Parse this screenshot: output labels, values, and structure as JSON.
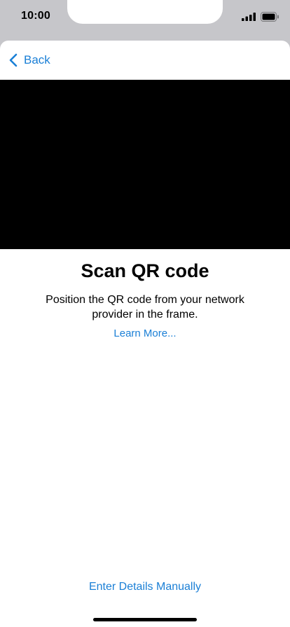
{
  "status_bar": {
    "time": "10:00",
    "signal_icon": "cellular-signal-icon",
    "battery_icon": "battery-icon"
  },
  "nav": {
    "back_label": "Back",
    "back_icon": "chevron-left-icon"
  },
  "main": {
    "title": "Scan QR code",
    "instructions": "Position the QR code from your network provider in the frame.",
    "learn_more": "Learn More..."
  },
  "footer": {
    "manual_button": "Enter Details Manually"
  },
  "colors": {
    "accent": "#1a7fd6",
    "camera_background": "#000000",
    "sheet_background": "#ffffff",
    "chrome_background": "#c6c6ca"
  }
}
